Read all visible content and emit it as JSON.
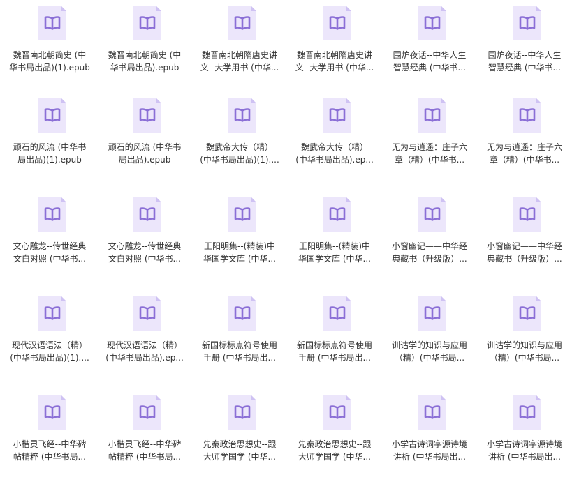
{
  "colors": {
    "icon_body": "#ece6fb",
    "icon_fold": "#cfc2f3",
    "icon_glyph": "#8b6fd6",
    "text": "#333333"
  },
  "icon_name": "ebook-file-icon",
  "files": [
    {
      "line1": "魏晋南北朝简史 (中",
      "line2": "华书局出品)(1).epub"
    },
    {
      "line1": "魏晋南北朝简史 (中",
      "line2": "华书局出品).epub"
    },
    {
      "line1": "魏晋南北朝隋唐史讲",
      "line2": "义--大学用书 (中华..."
    },
    {
      "line1": "魏晋南北朝隋唐史讲",
      "line2": "义--大学用书 (中华..."
    },
    {
      "line1": "围炉夜话--中华人生",
      "line2": "智慧经典 (中华书..."
    },
    {
      "line1": "围炉夜话--中华人生",
      "line2": "智慧经典 (中华书..."
    },
    {
      "line1": "顽石的风流 (中华书",
      "line2": "局出品)(1).epub"
    },
    {
      "line1": "顽石的风流 (中华书",
      "line2": "局出品).epub"
    },
    {
      "line1": "魏武帝大传（精）",
      "line2": "(中华书局出品)(1)...."
    },
    {
      "line1": "魏武帝大传（精）",
      "line2": "(中华书局出品).ep..."
    },
    {
      "line1": "无为与逍遥：庄子六",
      "line2": "章（精）(中华书..."
    },
    {
      "line1": "无为与逍遥：庄子六",
      "line2": "章（精）(中华书..."
    },
    {
      "line1": "文心雕龙--传世经典",
      "line2": "文白对照 (中华书..."
    },
    {
      "line1": "文心雕龙--传世经典",
      "line2": "文白对照 (中华书..."
    },
    {
      "line1": "王阳明集--(精装)中",
      "line2": "华国学文库 (中华..."
    },
    {
      "line1": "王阳明集--(精装)中",
      "line2": "华国学文库 (中华..."
    },
    {
      "line1": "小窗幽记——中华经",
      "line2": "典藏书（升级版）..."
    },
    {
      "line1": "小窗幽记——中华经",
      "line2": "典藏书（升级版）..."
    },
    {
      "line1": "现代汉语语法（精）",
      "line2": "(中华书局出品)(1)...."
    },
    {
      "line1": "现代汉语语法（精）",
      "line2": "(中华书局出品).ep..."
    },
    {
      "line1": "新国标标点符号使用",
      "line2": "手册 (中华书局出..."
    },
    {
      "line1": "新国标标点符号使用",
      "line2": "手册 (中华书局出..."
    },
    {
      "line1": "训诂学的知识与应用",
      "line2": "（精）(中华书局..."
    },
    {
      "line1": "训诂学的知识与应用",
      "line2": "（精）(中华书局..."
    },
    {
      "line1": "小楷灵飞经--中华碑",
      "line2": "帖精粹 (中华书局..."
    },
    {
      "line1": "小楷灵飞经--中华碑",
      "line2": "帖精粹 (中华书局..."
    },
    {
      "line1": "先秦政治思想史--跟",
      "line2": "大师学国学 (中华..."
    },
    {
      "line1": "先秦政治思想史--跟",
      "line2": "大师学国学 (中华..."
    },
    {
      "line1": "小学古诗词字源诗境",
      "line2": "讲析 (中华书局出..."
    },
    {
      "line1": "小学古诗词字源诗境",
      "line2": "讲析 (中华书局出..."
    }
  ]
}
